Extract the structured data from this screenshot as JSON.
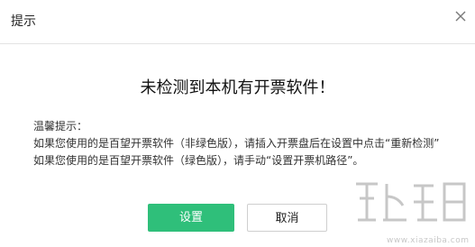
{
  "dialog": {
    "title": "提示",
    "headline": "未检测到本机有开票软件！",
    "tips": {
      "heading": "温馨提示：",
      "line1": "如果您使用的是百望开票软件（非绿色版），请插入开票盘后在设置中点击“重新检测”",
      "line2": "如果您使用的是百望开票软件（绿色版），请手动“设置开票机路径”。"
    },
    "buttons": {
      "primary": "设置",
      "secondary": "取消"
    }
  },
  "watermark": {
    "text": "www.xiazaiba.com"
  },
  "colors": {
    "primary": "#2fbf7a",
    "border": "#e3e3e3"
  },
  "icons": {
    "close": "close-icon",
    "watermark": "watermark-logo"
  }
}
